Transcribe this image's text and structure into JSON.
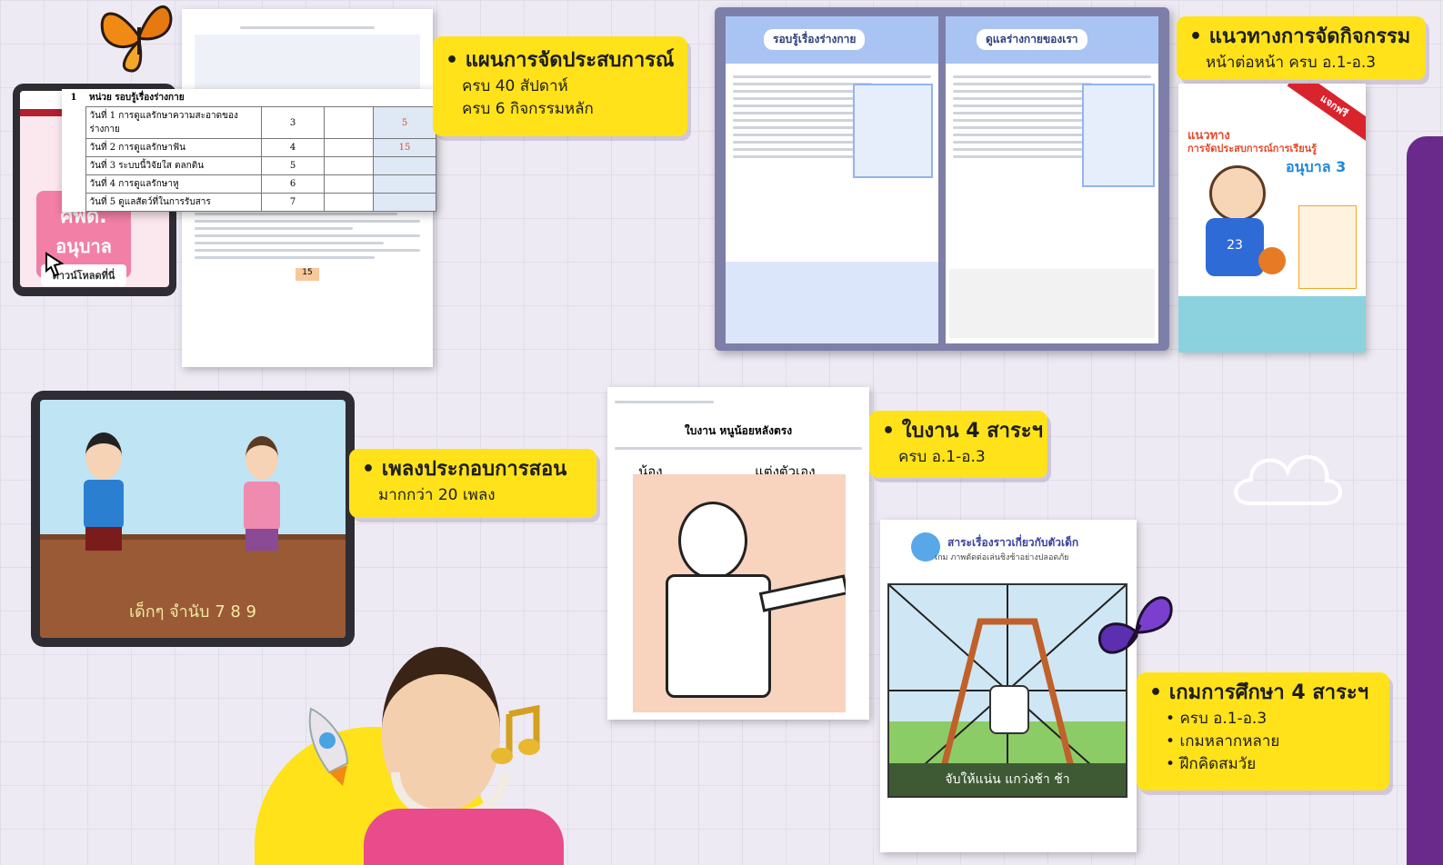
{
  "badges": {
    "plan": {
      "title": "แผนการจัดประสบการณ์",
      "lines": [
        "ครบ 40 สัปดาห์",
        "ครบ 6 กิจกรรมหลัก"
      ]
    },
    "guide": {
      "title": "แนวทางการจัดกิจกรรม",
      "lines": [
        "หน้าต่อหน้า ครบ อ.1-อ.3"
      ]
    },
    "songs": {
      "title": "เพลงประกอบการสอน",
      "lines": [
        "มากกว่า 20 เพลง"
      ]
    },
    "worksheets": {
      "title": "ใบงาน 4 สาระฯ",
      "lines": [
        "ครบ อ.1-อ.3"
      ]
    },
    "games": {
      "title": "เกมการศึกษา 4 สาระฯ",
      "lines": [
        "ครบ อ.1-อ.3",
        "เกมหลากหลาย",
        "ฝึกคิดสมวัย"
      ]
    }
  },
  "tablet_promo": {
    "line1": "ศพด.",
    "line2": "อนุบาล",
    "button": "ดาวน์โหลดที่นี่"
  },
  "plan_table": {
    "unit_no": "1",
    "unit_title": "หน่วย รอบรู้เรื่องร่างกาย",
    "rows": [
      {
        "label": "วันที่ 1 การดูแลรักษาความสะอาดของร่างกาย",
        "num": "3",
        "mark": "5"
      },
      {
        "label": "วันที่ 2 การดูแลรักษาฟัน",
        "num": "4",
        "mark": "15"
      },
      {
        "label": "วันที่ 3 ระบบนี้วิจัยใส ตลกติน",
        "num": "5",
        "mark": ""
      },
      {
        "label": "วันที่ 4 การดูแลรักษาหู",
        "num": "6",
        "mark": ""
      },
      {
        "label": "วันที่ 5 ดูแลสัตว์ที่ในการรับสาร",
        "num": "7",
        "mark": ""
      }
    ],
    "page_no": "15"
  },
  "book": {
    "left_title": "รอบรู้เรื่องร่างกาย",
    "right_title": "ดูแลร่างกายของเรา",
    "cover_line1": "แนวทาง",
    "cover_line2": "การจัดประสบการณ์การเรียนรู้",
    "cover_level": "อนุบาล 3",
    "cover_ribbon": "แจกฟรี",
    "player_number": "23"
  },
  "video": {
    "caption": "เด็กๆ จำนับ 7 8 9"
  },
  "worksheet": {
    "header": "ใบงาน หนูน้อยหลังตรง",
    "fill_prefix": "น้อง",
    "fill_suffix": "แต่งตัวเอง"
  },
  "game_card": {
    "title": "สาระเรื่องราวเกี่ยวกับตัวเด็ก",
    "subtitle": "เกม ภาพตัดต่อเล่นชิงช้าอย่างปลอดภัย",
    "caption": "จับให้แน่น แกว่งช้า ช้า"
  },
  "colors": {
    "badge": "#ffe21a",
    "accent_purple": "#6a2a8c",
    "promo_pink": "#f27fa6"
  }
}
